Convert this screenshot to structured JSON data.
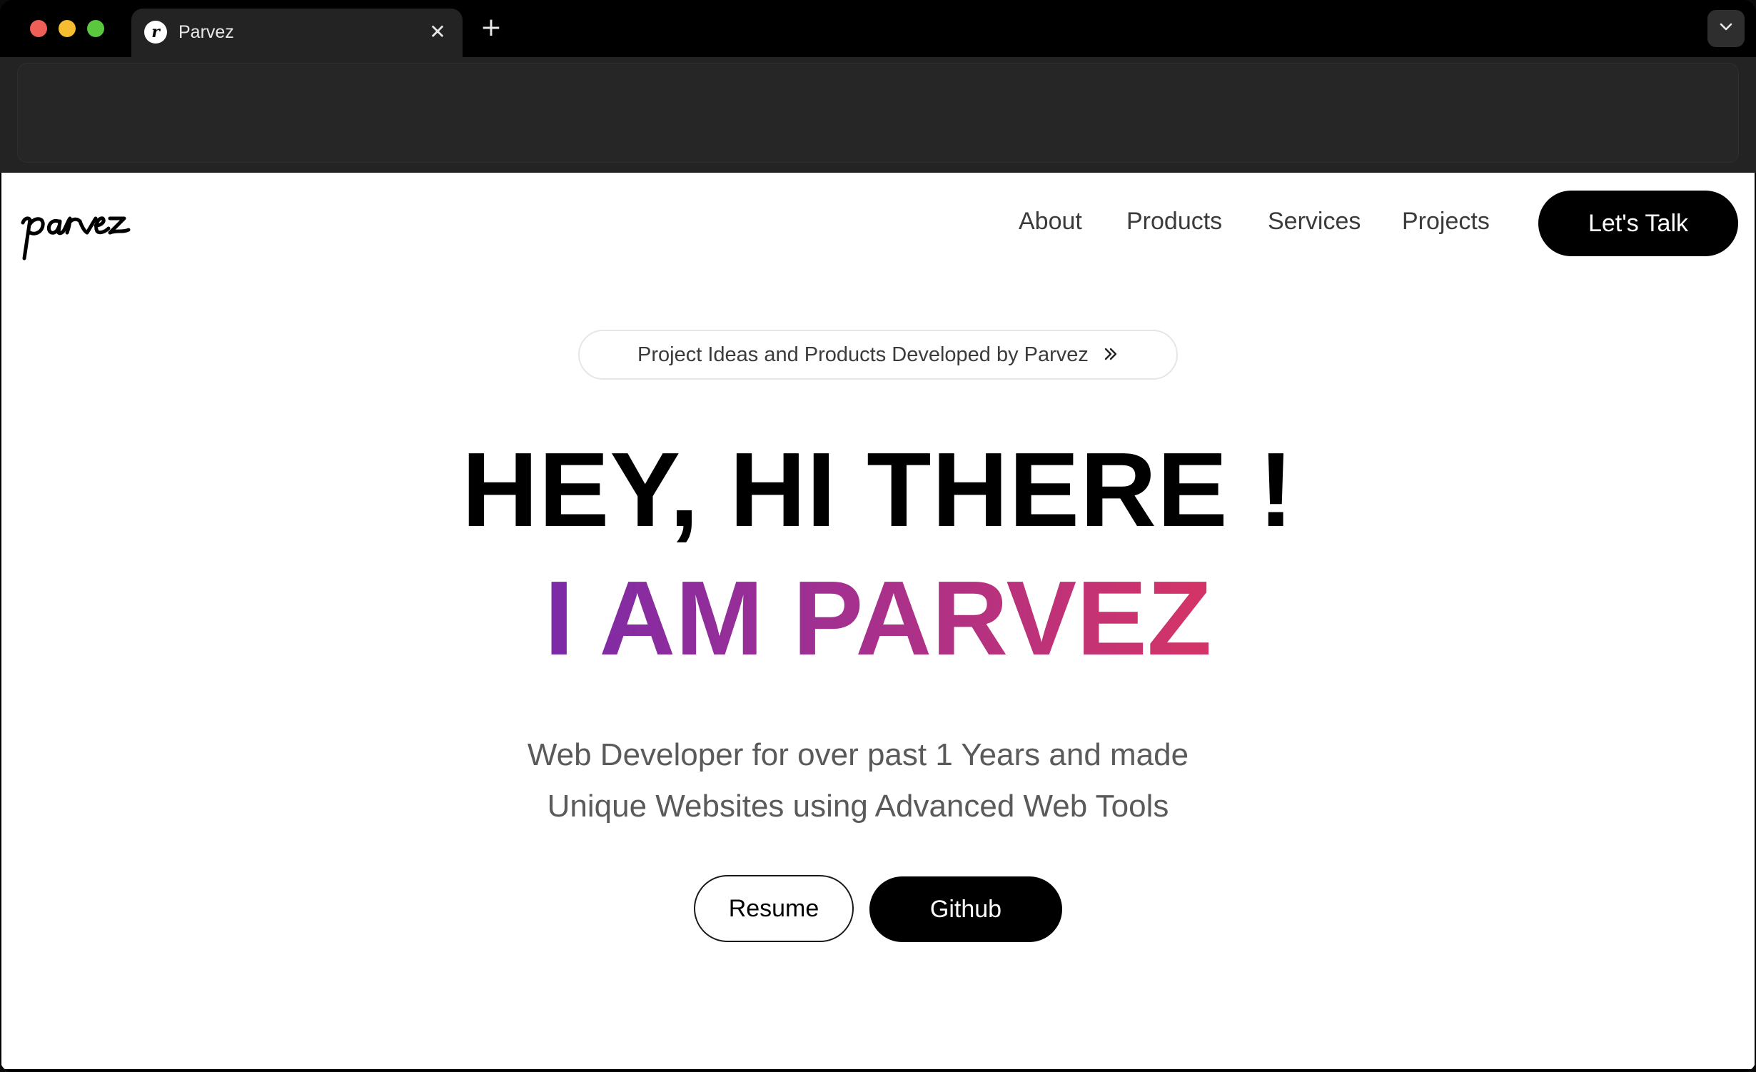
{
  "browser": {
    "tab_title": "Parvez",
    "favicon_letter": "r",
    "close_glyph": "✕",
    "new_tab_glyph": "+"
  },
  "site": {
    "logo_text": "parvez",
    "nav": {
      "about": "About",
      "products": "Products",
      "services": "Services",
      "projects": "Projects"
    },
    "cta": "Let's Talk"
  },
  "hero": {
    "pill_text": "Project Ideas and Products Developed by Parvez",
    "headline": "HEY, HI THERE !",
    "name_line": "I AM PARVEZ",
    "subtitle_line1": "Web Developer for over past 1 Years and made",
    "subtitle_line2": "Unique Websites using Advanced Web Tools",
    "resume_button": "Resume",
    "github_button": "Github"
  },
  "colors": {
    "gradient_start": "#7b2aa8",
    "gradient_end": "#d43466",
    "cta_background": "#000000"
  },
  "icons": {
    "pill_arrow": "chevrons-right-icon",
    "tab_dropdown": "chevron-down-icon"
  }
}
